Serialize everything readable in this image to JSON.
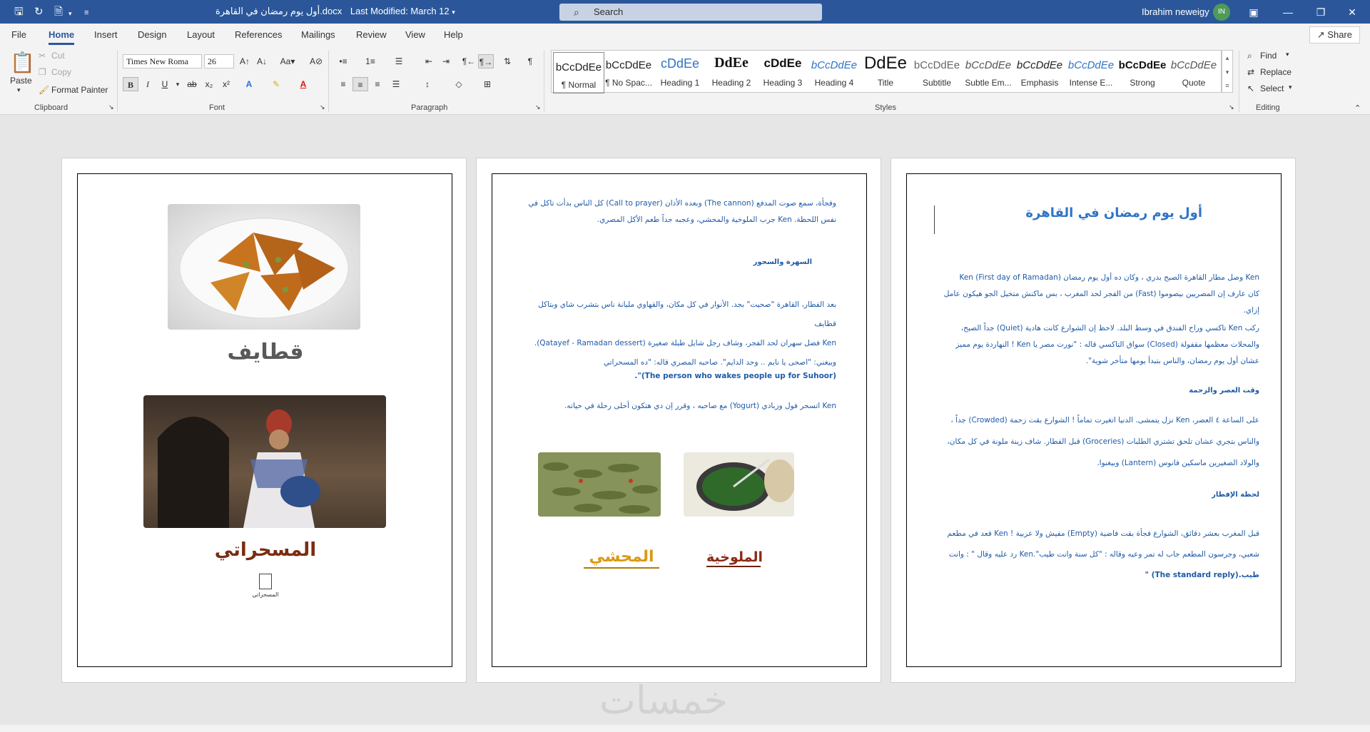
{
  "window": {
    "doc_title": "أول يوم رمضان في القاهرة.docx",
    "last_modified": "Last Modified: March 12",
    "search_placeholder": "Search",
    "user_name": "Ibrahim neweigy",
    "user_initials": "IN"
  },
  "tabs": [
    "File",
    "Home",
    "Insert",
    "Design",
    "Layout",
    "References",
    "Mailings",
    "Review",
    "View",
    "Help"
  ],
  "share_label": "Share",
  "ribbon": {
    "clipboard": {
      "paste": "Paste",
      "cut": "Cut",
      "copy": "Copy",
      "format_painter": "Format Painter",
      "label": "Clipboard"
    },
    "font": {
      "name": "Times New Roma",
      "size": "26",
      "label": "Font"
    },
    "paragraph_label": "Paragraph",
    "styles_label": "Styles",
    "styles": [
      {
        "preview": "bCcDdEe",
        "name": "¶ Normal"
      },
      {
        "preview": "bCcDdEe",
        "name": "¶ No Spac..."
      },
      {
        "preview": "cDdEe",
        "name": "Heading 1"
      },
      {
        "preview": "DdEe",
        "name": "Heading 2"
      },
      {
        "preview": "cDdEe",
        "name": "Heading 3"
      },
      {
        "preview": "bCcDdEe",
        "name": "Heading 4"
      },
      {
        "preview": "DdEe",
        "name": "Title"
      },
      {
        "preview": "bCcDdEe",
        "name": "Subtitle"
      },
      {
        "preview": "bCcDdEe",
        "name": "Subtle Em..."
      },
      {
        "preview": "bCcDdEe",
        "name": "Emphasis"
      },
      {
        "preview": "bCcDdEe",
        "name": "Intense E..."
      },
      {
        "preview": "bCcDdEe",
        "name": "Strong"
      },
      {
        "preview": "bCcDdEe",
        "name": "Quote"
      }
    ],
    "editing": {
      "find": "Find",
      "replace": "Replace",
      "select": "Select",
      "label": "Editing"
    }
  },
  "page1": {
    "title": "أول يوم رمضان في القاهرة",
    "p1_l1": "Ken وصل مطار القاهرة الصبح بدري ، وكان ده أول يوم رمضان (First day of Ramadan) Ken",
    "p1_l2": "كان عارف إن المصريين بيصوموا (Fast) من الفجر لحد المغرب ، بس ماكنش متخيل الجو هيكون عامل",
    "p1_l3": "إزاي.",
    "p2_l1": "ركب Ken تاكسي وراح الفندق في وسط البلد. لاحظ إن الشوارع كانت هادية (Quiet) جداً الصبح،",
    "p2_l2": "والمحلات معظمها مقفولة (Closed) سواق التاكسي قاله : \"نورت مصر يا Ken ! النهاردة يوم مميز",
    "p2_l3": "عشان أول يوم رمضان، والناس بتبدأ يومها متأخر شوية\".",
    "h2": "وقت العصر والزحمة",
    "p3_l1": "على الساعة ٤ العصر، Ken نزل يتمشى. الدنيا اتغيرت تماماً ! الشوارع بقت زحمة (Crowded) جداً ،",
    "p3_l2": "والناس بتجري عشان تلحق تشتري الطلبات (Groceries) قبل الفطار. شاف زينة ملونة في كل مكان،",
    "p3_l3": "والولاد الصغيرين ماسكين فانوس (Lantern) وبيغنوا.",
    "h3": "لحظة الإفطار",
    "p4_l1": "قبل المغرب بعشر دقائق، الشوارع فجأة بقت فاضية (Empty) مفيش ولا عربية ! Ken قعد في مطعم",
    "p4_l2": "شعبي، وجرسون المطعم جاب له تمر وعيه وقاله : \"كل سنة وانت طيب\".Ken رد عليه وقال \" : وانت",
    "p4_l3": "طيب.(The standard reply) \""
  },
  "page2": {
    "p1_l1": "وفجأة، سمع صوت المدفع (The cannon) وبعده الأذان (Call to prayer) كل الناس بدأت تاكل في",
    "p1_l2": "نفس اللحظة. Ken جرب الملوخية والمحشي، وعجبه جداً طعم الأكل المصري.",
    "h1": "السهرة والسحور",
    "p2_l1": "بعد الفطار، القاهرة \"صحيت\" بجد. الأنوار في كل مكان، والقهاوي مليانة ناس بتشرب شاي وبتاكل قطايف",
    "p2_l2": "Ken فضل سهران لحد الفجر، وشاف رجل شايل طبلة صغيرة (Qatayef - Ramadan dessert).",
    "p2_l3": "وبيغني: \"اصحى يا نايم .. وحد الدايم\". صاحبه المصري قاله: \"ده المسحراتي",
    "p2_l4": "(The person who wakes people up for Suhoor)\".",
    "p3_l1": "Ken اتسحر فول وزبادي (Yogurt) مع صاحبه ، وقرر إن دي هتكون أحلى رحلة في حياته.",
    "cap_mahshi": "المحشي",
    "cap_molokhia": "الملوخية"
  },
  "page3": {
    "cap_qatayef": "قطايف",
    "cap_mesaharati": "المسحراتي",
    "file_icon_label": "المسحراتي"
  },
  "watermark": "خمسات"
}
